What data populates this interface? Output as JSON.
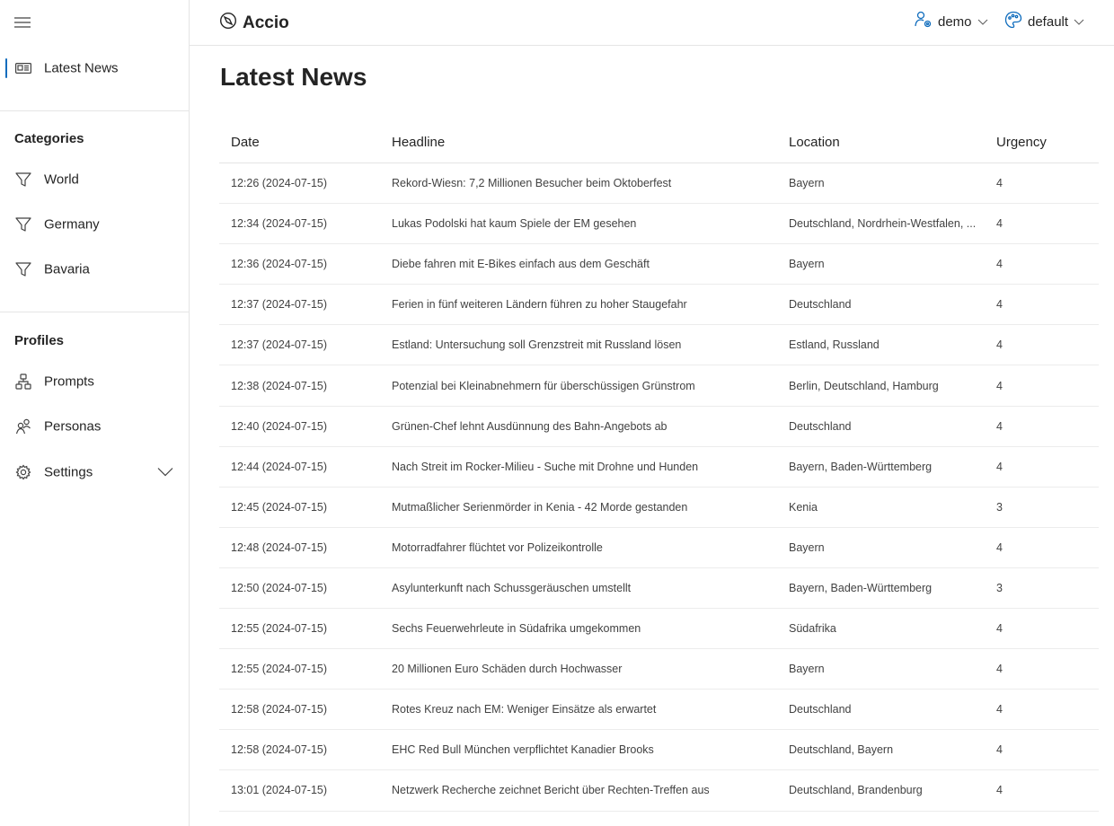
{
  "sidebar": {
    "main_item": {
      "label": "Latest News",
      "icon": "newspaper-icon"
    },
    "categories": {
      "heading": "Categories",
      "items": [
        {
          "label": "World",
          "icon": "filter-icon"
        },
        {
          "label": "Germany",
          "icon": "filter-icon"
        },
        {
          "label": "Bavaria",
          "icon": "filter-icon"
        }
      ]
    },
    "profiles": {
      "heading": "Profiles",
      "items": [
        {
          "label": "Prompts",
          "icon": "flowchart-icon"
        },
        {
          "label": "Personas",
          "icon": "people-icon"
        },
        {
          "label": "Settings",
          "icon": "gear-icon"
        }
      ]
    }
  },
  "header": {
    "brand": "Accio",
    "user_menu": "demo",
    "theme_menu": "default"
  },
  "main": {
    "title": "Latest News",
    "columns": [
      "Date",
      "Headline",
      "Location",
      "Urgency"
    ],
    "rows": [
      {
        "date": "12:26 (2024-07-15)",
        "headline": "Rekord-Wiesn: 7,2 Millionen Besucher beim Oktoberfest",
        "location": "Bayern",
        "urgency": "4"
      },
      {
        "date": "12:34 (2024-07-15)",
        "headline": "Lukas Podolski hat kaum Spiele der EM gesehen",
        "location": "Deutschland, Nordrhein-Westfalen, ...",
        "urgency": "4"
      },
      {
        "date": "12:36 (2024-07-15)",
        "headline": "Diebe fahren mit E-Bikes einfach aus dem Geschäft",
        "location": "Bayern",
        "urgency": "4"
      },
      {
        "date": "12:37 (2024-07-15)",
        "headline": "Ferien in fünf weiteren Ländern führen zu hoher Staugefahr",
        "location": "Deutschland",
        "urgency": "4"
      },
      {
        "date": "12:37 (2024-07-15)",
        "headline": "Estland: Untersuchung soll Grenzstreit mit Russland lösen",
        "location": "Estland, Russland",
        "urgency": "4"
      },
      {
        "date": "12:38 (2024-07-15)",
        "headline": "Potenzial bei Kleinabnehmern für überschüssigen Grünstrom",
        "location": "Berlin, Deutschland, Hamburg",
        "urgency": "4"
      },
      {
        "date": "12:40 (2024-07-15)",
        "headline": "Grünen-Chef lehnt Ausdünnung des Bahn-Angebots ab",
        "location": "Deutschland",
        "urgency": "4"
      },
      {
        "date": "12:44 (2024-07-15)",
        "headline": "Nach Streit im Rocker-Milieu - Suche mit Drohne und Hunden",
        "location": "Bayern, Baden-Württemberg",
        "urgency": "4"
      },
      {
        "date": "12:45 (2024-07-15)",
        "headline": "Mutmaßlicher Serienmörder in Kenia - 42 Morde gestanden",
        "location": "Kenia",
        "urgency": "3"
      },
      {
        "date": "12:48 (2024-07-15)",
        "headline": "Motorradfahrer flüchtet vor Polizeikontrolle",
        "location": "Bayern",
        "urgency": "4"
      },
      {
        "date": "12:50 (2024-07-15)",
        "headline": "Asylunterkunft nach Schussgeräuschen umstellt",
        "location": "Bayern, Baden-Württemberg",
        "urgency": "3"
      },
      {
        "date": "12:55 (2024-07-15)",
        "headline": "Sechs Feuerwehrleute in Südafrika umgekommen",
        "location": "Südafrika",
        "urgency": "4"
      },
      {
        "date": "12:55 (2024-07-15)",
        "headline": "20 Millionen Euro Schäden durch Hochwasser",
        "location": "Bayern",
        "urgency": "4"
      },
      {
        "date": "12:58 (2024-07-15)",
        "headline": "Rotes Kreuz nach EM: Weniger Einsätze als erwartet",
        "location": "Deutschland",
        "urgency": "4"
      },
      {
        "date": "12:58 (2024-07-15)",
        "headline": "EHC Red Bull München verpflichtet Kanadier Brooks",
        "location": "Deutschland, Bayern",
        "urgency": "4"
      },
      {
        "date": "13:01 (2024-07-15)",
        "headline": "Netzwerk Recherche zeichnet Bericht über Rechten-Treffen aus",
        "location": "Deutschland, Brandenburg",
        "urgency": "4"
      }
    ]
  },
  "colors": {
    "accent": "#0f6cbd",
    "border": "#e5e5e5",
    "text": "#242424",
    "text_secondary": "#424242"
  }
}
